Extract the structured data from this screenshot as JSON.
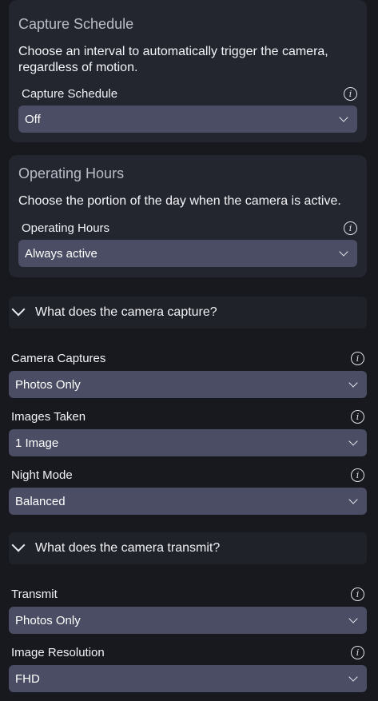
{
  "capture_schedule_card": {
    "title": "Capture Schedule",
    "description": "Choose an interval to automatically trigger the camera, regardless of motion.",
    "field_label": "Capture Schedule",
    "value": "Off"
  },
  "operating_hours_card": {
    "title": "Operating Hours",
    "description": "Choose the portion of the day when the camera is active.",
    "field_label": "Operating Hours",
    "value": "Always active"
  },
  "capture_section": {
    "title": "What does the camera capture?",
    "fields": [
      {
        "label": "Camera Captures",
        "value": "Photos Only"
      },
      {
        "label": "Images Taken",
        "value": "1 Image"
      },
      {
        "label": "Night Mode",
        "value": "Balanced"
      }
    ]
  },
  "transmit_section": {
    "title": "What does the camera transmit?",
    "fields": [
      {
        "label": "Transmit",
        "value": "Photos Only"
      },
      {
        "label": "Image Resolution",
        "value": "FHD"
      }
    ]
  },
  "icons": {
    "info": "info-icon",
    "dropdown": "chevron-down-icon",
    "section_toggle": "chevron-down-icon"
  },
  "colors": {
    "background": "#17191f",
    "card": "#23262f",
    "select": "#4a4d63",
    "text": "#eef0f4"
  }
}
